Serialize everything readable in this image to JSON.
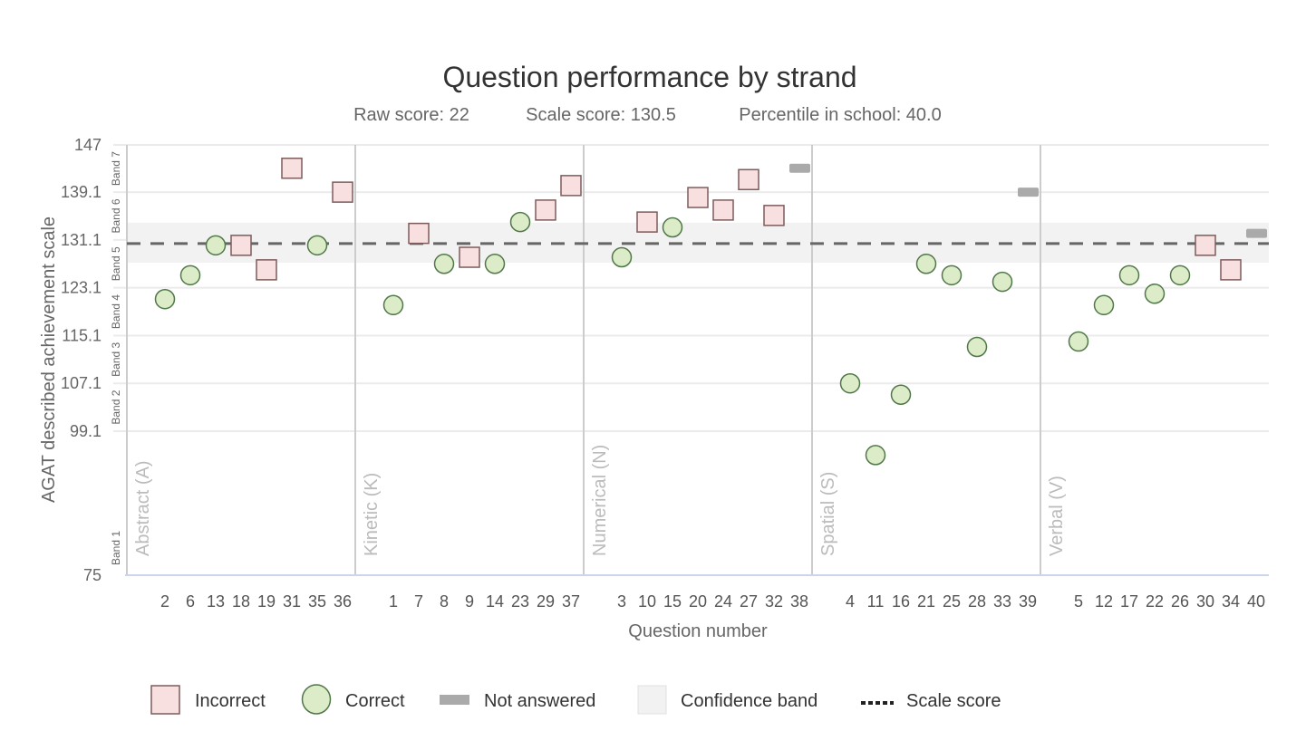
{
  "chart_data": {
    "type": "scatter",
    "title": "Question performance by strand",
    "subtitle": {
      "raw_score": "Raw score: 22",
      "scale_score": "Scale score: 130.5",
      "percentile": "Percentile in school: 40.0"
    },
    "xlabel": "Question number",
    "ylabel": "AGAT described achievement scale",
    "ylim": [
      75,
      147
    ],
    "yticks": [
      {
        "value": 147,
        "label": "147"
      },
      {
        "value": 139.1,
        "label": "139.1"
      },
      {
        "value": 131.1,
        "label": "131.1"
      },
      {
        "value": 123.1,
        "label": "123.1"
      },
      {
        "value": 115.1,
        "label": "115.1"
      },
      {
        "value": 107.1,
        "label": "107.1"
      },
      {
        "value": 99.1,
        "label": "99.1"
      },
      {
        "value": 75,
        "label": "75"
      }
    ],
    "bands": [
      {
        "label": "Band 1",
        "from": 75,
        "to": 99.1
      },
      {
        "label": "Band 2",
        "from": 99.1,
        "to": 107.1
      },
      {
        "label": "Band 3",
        "from": 107.1,
        "to": 115.1
      },
      {
        "label": "Band 4",
        "from": 115.1,
        "to": 123.1
      },
      {
        "label": "Band 5",
        "from": 123.1,
        "to": 131.1
      },
      {
        "label": "Band 6",
        "from": 131.1,
        "to": 139.1
      },
      {
        "label": "Band 7",
        "from": 139.1,
        "to": 147
      }
    ],
    "scale_score": 130.5,
    "confidence_band": [
      127.3,
      134.0
    ],
    "grid": true,
    "legend_position": "bottom",
    "strands": [
      {
        "name": "Abstract (A)",
        "questions": [
          {
            "q": "2",
            "value": 121.2,
            "status": "correct"
          },
          {
            "q": "6",
            "value": 125.2,
            "status": "correct"
          },
          {
            "q": "13",
            "value": 130.2,
            "status": "correct"
          },
          {
            "q": "18",
            "value": 130.2,
            "status": "incorrect"
          },
          {
            "q": "19",
            "value": 126.1,
            "status": "incorrect"
          },
          {
            "q": "31",
            "value": 143.1,
            "status": "incorrect"
          },
          {
            "q": "35",
            "value": 130.2,
            "status": "correct"
          },
          {
            "q": "36",
            "value": 139.1,
            "status": "incorrect"
          }
        ]
      },
      {
        "name": "Kinetic (K)",
        "questions": [
          {
            "q": "1",
            "value": 120.2,
            "status": "correct"
          },
          {
            "q": "7",
            "value": 132.2,
            "status": "incorrect"
          },
          {
            "q": "8",
            "value": 127.1,
            "status": "correct"
          },
          {
            "q": "9",
            "value": 128.2,
            "status": "incorrect"
          },
          {
            "q": "14",
            "value": 127.1,
            "status": "correct"
          },
          {
            "q": "23",
            "value": 134.1,
            "status": "correct"
          },
          {
            "q": "29",
            "value": 136.1,
            "status": "incorrect"
          },
          {
            "q": "37",
            "value": 140.2,
            "status": "incorrect"
          }
        ]
      },
      {
        "name": "Numerical (N)",
        "questions": [
          {
            "q": "3",
            "value": 128.2,
            "status": "correct"
          },
          {
            "q": "10",
            "value": 134.1,
            "status": "incorrect"
          },
          {
            "q": "15",
            "value": 133.2,
            "status": "correct"
          },
          {
            "q": "20",
            "value": 138.2,
            "status": "incorrect"
          },
          {
            "q": "24",
            "value": 136.1,
            "status": "incorrect"
          },
          {
            "q": "27",
            "value": 141.2,
            "status": "incorrect"
          },
          {
            "q": "32",
            "value": 135.2,
            "status": "incorrect"
          },
          {
            "q": "38",
            "value": 143.1,
            "status": "not_answered"
          }
        ]
      },
      {
        "name": "Spatial (S)",
        "questions": [
          {
            "q": "4",
            "value": 107.1,
            "status": "correct"
          },
          {
            "q": "11",
            "value": 95.1,
            "status": "correct"
          },
          {
            "q": "16",
            "value": 105.2,
            "status": "correct"
          },
          {
            "q": "21",
            "value": 127.1,
            "status": "correct"
          },
          {
            "q": "25",
            "value": 125.2,
            "status": "correct"
          },
          {
            "q": "28",
            "value": 113.2,
            "status": "correct"
          },
          {
            "q": "33",
            "value": 124.1,
            "status": "correct"
          },
          {
            "q": "39",
            "value": 139.1,
            "status": "not_answered"
          }
        ]
      },
      {
        "name": "Verbal (V)",
        "questions": [
          {
            "q": "5",
            "value": 114.1,
            "status": "correct"
          },
          {
            "q": "12",
            "value": 120.2,
            "status": "correct"
          },
          {
            "q": "17",
            "value": 125.2,
            "status": "correct"
          },
          {
            "q": "22",
            "value": 122.1,
            "status": "correct"
          },
          {
            "q": "26",
            "value": 125.2,
            "status": "correct"
          },
          {
            "q": "30",
            "value": 130.2,
            "status": "incorrect"
          },
          {
            "q": "34",
            "value": 126.1,
            "status": "incorrect"
          },
          {
            "q": "40",
            "value": 132.2,
            "status": "not_answered"
          }
        ]
      }
    ],
    "legend": [
      {
        "key": "incorrect",
        "label": "Incorrect"
      },
      {
        "key": "correct",
        "label": "Correct"
      },
      {
        "key": "not_answered",
        "label": "Not answered"
      },
      {
        "key": "confidence_band",
        "label": "Confidence band"
      },
      {
        "key": "scale_score",
        "label": "Scale score"
      }
    ],
    "colors": {
      "incorrect_fill": "#f9e0e0",
      "incorrect_stroke": "#7d5c5c",
      "correct_fill": "#dcebc8",
      "correct_stroke": "#4f7748",
      "not_answered": "#aaaaaa",
      "confidence_band": "#f2f2f2",
      "scale_score_line": "#666666",
      "grid": "#ebebeb",
      "strand_divider": "#cccccc",
      "x_axis": "#ccd6eb"
    }
  }
}
